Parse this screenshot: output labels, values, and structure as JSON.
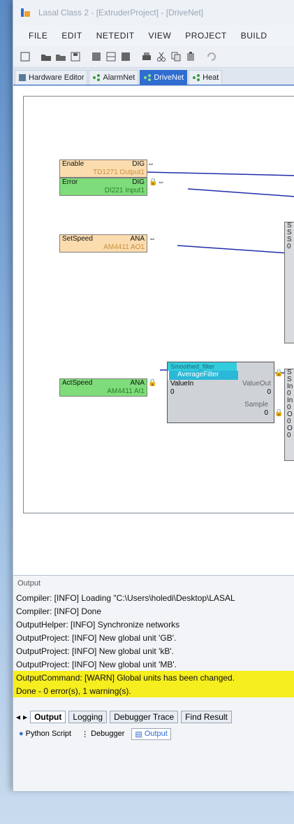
{
  "window": {
    "title": "Lasal Class 2 - [ExtruderProject] - [DriveNet]"
  },
  "menu": [
    "FILE",
    "EDIT",
    "NETEDIT",
    "VIEW",
    "PROJECT",
    "BUILD"
  ],
  "toolbar_icons": [
    "new-file-icon",
    "open-folder-icon",
    "open-project-icon",
    "save-icon",
    "save-all-icon",
    "view-icon",
    "grid-icon",
    "print-icon",
    "cut-icon",
    "copy-icon",
    "paste-icon",
    "undo-icon"
  ],
  "tabs": [
    {
      "label": "Hardware Editor",
      "icon": "hardware-icon"
    },
    {
      "label": "AlarmNet",
      "icon": "net-icon"
    },
    {
      "label": "DriveNet",
      "icon": "net-icon",
      "active": true
    },
    {
      "label": "Heat",
      "icon": "net-icon"
    }
  ],
  "blocks": {
    "enable": {
      "name": "Enable",
      "type": "DIG",
      "addr": "TD1271 Output1"
    },
    "error": {
      "name": "Error",
      "type": "DIG",
      "addr": "DI221 Input1"
    },
    "setspeed": {
      "name": "SetSpeed",
      "type": "ANA",
      "addr": "AM4411 AO1"
    },
    "actspeed": {
      "name": "ActSpeed",
      "type": "ANA",
      "addr": "AM4411 AI1"
    },
    "filter": {
      "name": "AverageFilter",
      "header_top": "Smoothed_filter",
      "input_name": "ValueIn",
      "input_value": "0",
      "output_name": "ValueOut",
      "output_value": "0",
      "sample_label": "Sample",
      "sample_value": "0"
    }
  },
  "output": {
    "title": "Output",
    "lines": [
      {
        "text": "Compiler: [INFO] Loading \"C:\\Users\\holedi\\Desktop\\LASAL",
        "warn": false
      },
      {
        "text": "Compiler: [INFO] Done",
        "warn": false
      },
      {
        "text": "OutputHelper: [INFO] Synchronize networks",
        "warn": false
      },
      {
        "text": "OutputProject: [INFO] New global unit 'GB'.",
        "warn": false
      },
      {
        "text": "OutputProject: [INFO] New global unit 'kB'.",
        "warn": false
      },
      {
        "text": "OutputProject: [INFO] New global unit 'MB'.",
        "warn": false
      },
      {
        "text": "OutputCommand: [WARN] Global units has been changed.",
        "warn": true
      },
      {
        "text": "Done - 0 error(s), 1 warning(s).",
        "warn": true
      }
    ],
    "bottom_tabs": [
      "Output",
      "Logging",
      "Debugger Trace",
      "Find Result"
    ],
    "pane_tabs": [
      "Python Script",
      "Debugger",
      "Output"
    ]
  }
}
